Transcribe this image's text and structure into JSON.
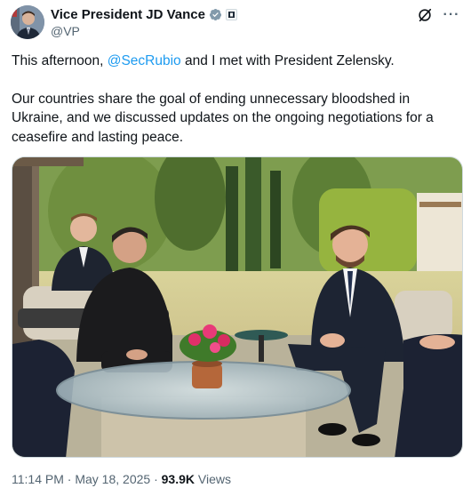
{
  "post": {
    "author": {
      "display_name": "Vice President JD Vance",
      "handle": "@VP",
      "verified_badge": "verified-gray-badge",
      "affiliation_badge": "government-affiliation-badge"
    },
    "text": {
      "intro_before": "This afternoon, ",
      "mention": "@SecRubio",
      "intro_after": " and I met with President Zelensky.",
      "paragraph2": "Our countries share the goal of ending unnecessary bloodshed in Ukraine, and we discussed updates on the ongoing negotiations for a ceasefire and lasting peace."
    },
    "meta": {
      "time": "11:14 PM",
      "separator": " · ",
      "date": "May 18, 2025",
      "views_count": "93.9K",
      "views_label": " Views"
    }
  },
  "actions": {
    "grok_icon": "grok-icon",
    "more_icon": "more-icon",
    "more_glyph": "···"
  },
  "colors": {
    "link": "#1d9bf0",
    "text": "#0f1419",
    "muted": "#536471",
    "border": "#cfd9de"
  }
}
